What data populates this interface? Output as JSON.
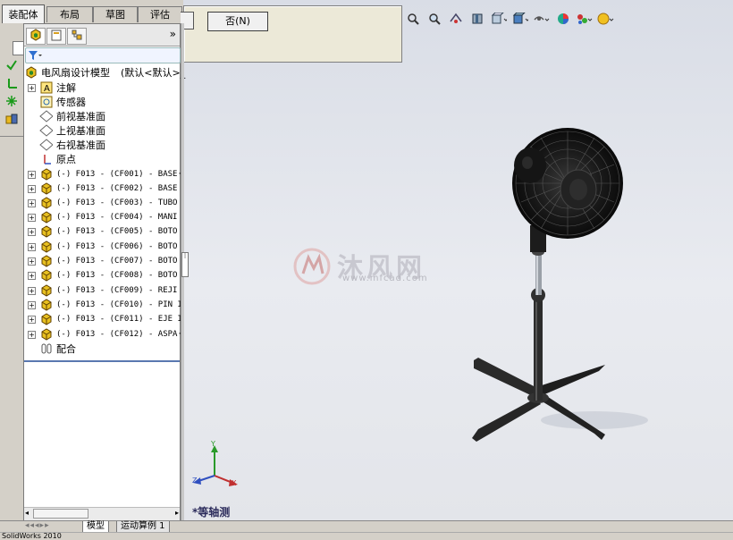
{
  "command_manager": {
    "tabs": [
      "装配体",
      "布局",
      "草图",
      "评估"
    ],
    "active_tab": "装配体"
  },
  "dialog": {
    "no_button": "否(N)"
  },
  "feature_manager": {
    "root_label": "电风扇设计模型",
    "root_config": "(默认<默认>_",
    "items": [
      {
        "label": "注解",
        "icon": "annotation-icon",
        "expandable": true
      },
      {
        "label": "传感器",
        "icon": "sensor-icon",
        "expandable": false
      },
      {
        "label": "前视基准面",
        "icon": "plane-icon",
        "expandable": false
      },
      {
        "label": "上视基准面",
        "icon": "plane-icon",
        "expandable": false
      },
      {
        "label": "右视基准面",
        "icon": "plane-icon",
        "expandable": false
      },
      {
        "label": "原点",
        "icon": "origin-icon",
        "expandable": false
      }
    ],
    "components": [
      "(-) F013 - (CF001) - BASE·",
      "(-) F013 - (CF002) - BASE ",
      "(-) F013 - (CF003) - TUBO ",
      "(-) F013 - (CF004) - MANI",
      "(-) F013 - (CF005) - BOTO",
      "(-) F013 - (CF006) - BOTO",
      "(-) F013 - (CF007) - BOTO",
      "(-) F013 - (CF008) - BOTO",
      "(-) F013 - (CF009) - REJI",
      "(-) F013 - (CF010) - PIN I",
      "(-) F013 - (CF011) - EJE I",
      "(-) F013 - (CF012) - ASPA·"
    ],
    "mates_label": "配合",
    "filter_icon": "filter-icon"
  },
  "viewport": {
    "view_label": "*等轴测",
    "watermark_text": "沐风网",
    "watermark_url": "www.mfcad.com",
    "axis_labels": {
      "x": "X",
      "y": "Y",
      "z": "Z"
    }
  },
  "bottom_tabs": [
    "模型",
    "运动算例 1"
  ],
  "status_text": "SolidWorks 2010",
  "colors": {
    "tab_active": "#f2f2f2",
    "viewport_top": "#d9dde6",
    "tree_divider": "#5a78b0"
  }
}
